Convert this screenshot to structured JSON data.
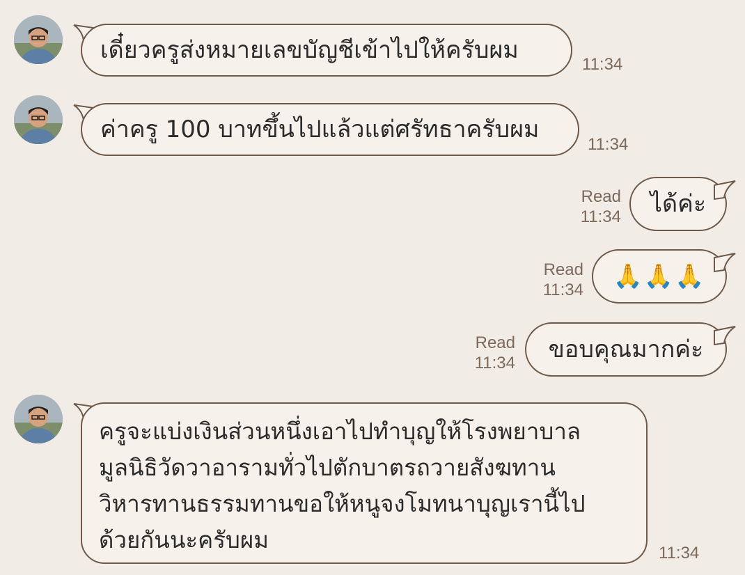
{
  "messages": [
    {
      "id": "m1",
      "side": "incoming",
      "text": "เดี๋ยวครูส่งหมายเลขบัญชีเข้าไปให้ครับผม",
      "time": "11:34"
    },
    {
      "id": "m2",
      "side": "incoming",
      "text": "ค่าครู 100 บาทขึ้นไปแล้วแต่ศรัทธาครับผม",
      "time": "11:34"
    },
    {
      "id": "m3",
      "side": "outgoing",
      "text": "ได้ค่ะ",
      "status": "Read",
      "time": "11:34"
    },
    {
      "id": "m4",
      "side": "outgoing",
      "text": "🙏🙏🙏",
      "status": "Read",
      "time": "11:34"
    },
    {
      "id": "m5",
      "side": "outgoing",
      "text": "ขอบคุณมากค่ะ",
      "status": "Read",
      "time": "11:34"
    },
    {
      "id": "m6",
      "side": "incoming",
      "lines": [
        "ครูจะแบ่งเงินส่วนหนึ่งเอาไปทำบุญให้โรงพยาบาล",
        "มูลนิธิวัดวาอารามทั่วไปตักบาตรถวายสังฆทาน",
        "วิหารทานธรรมทานขอให้หนูจงโมทนาบุญเรานี้ไป",
        "ด้วยกันนะครับผม"
      ],
      "time": "11:34"
    }
  ],
  "colors": {
    "background": "#f1ece5",
    "bubble": "#f6f1ea",
    "border": "#6e5a4b",
    "timestamp": "#7d6a5c"
  },
  "icons": {
    "avatar": "teacher-profile-photo"
  }
}
